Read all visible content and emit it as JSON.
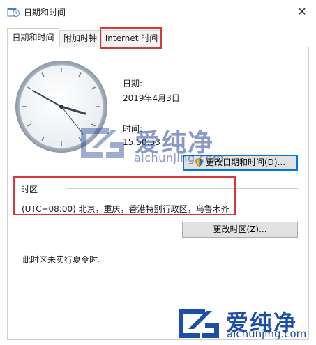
{
  "window": {
    "title": "日期和时间",
    "close_glyph": "✕"
  },
  "tabs": [
    {
      "label": "日期和时间",
      "active": true
    },
    {
      "label": "附加时钟",
      "active": false
    },
    {
      "label": "Internet 时间",
      "active": false,
      "highlighted": true
    }
  ],
  "datetime": {
    "date_label": "日期:",
    "date_value": "2019年4月3日",
    "time_label": "时间:",
    "time_value": "15:50:53",
    "change_button": "更改日期和时间(D)..."
  },
  "timezone": {
    "section_label": "时区",
    "value": "(UTC+08:00) 北京，重庆，香港特别行政区，乌鲁木齐",
    "change_button": "更改时区(Z)...",
    "highlighted": true
  },
  "dst_note": "此时区未实行夏令时。",
  "watermarks": [
    {
      "cn": "爱纯净",
      "en": "aichunjing.com"
    },
    {
      "cn": "爱纯净",
      "en": "aichunjing.com"
    }
  ],
  "colors": {
    "highlight": "#d03a3a",
    "focus": "#0078d7",
    "watermark": "#1b4fa8"
  },
  "icons": [
    "datetime-app-icon",
    "close-icon",
    "uac-shield-icon",
    "analog-clock-icon"
  ]
}
